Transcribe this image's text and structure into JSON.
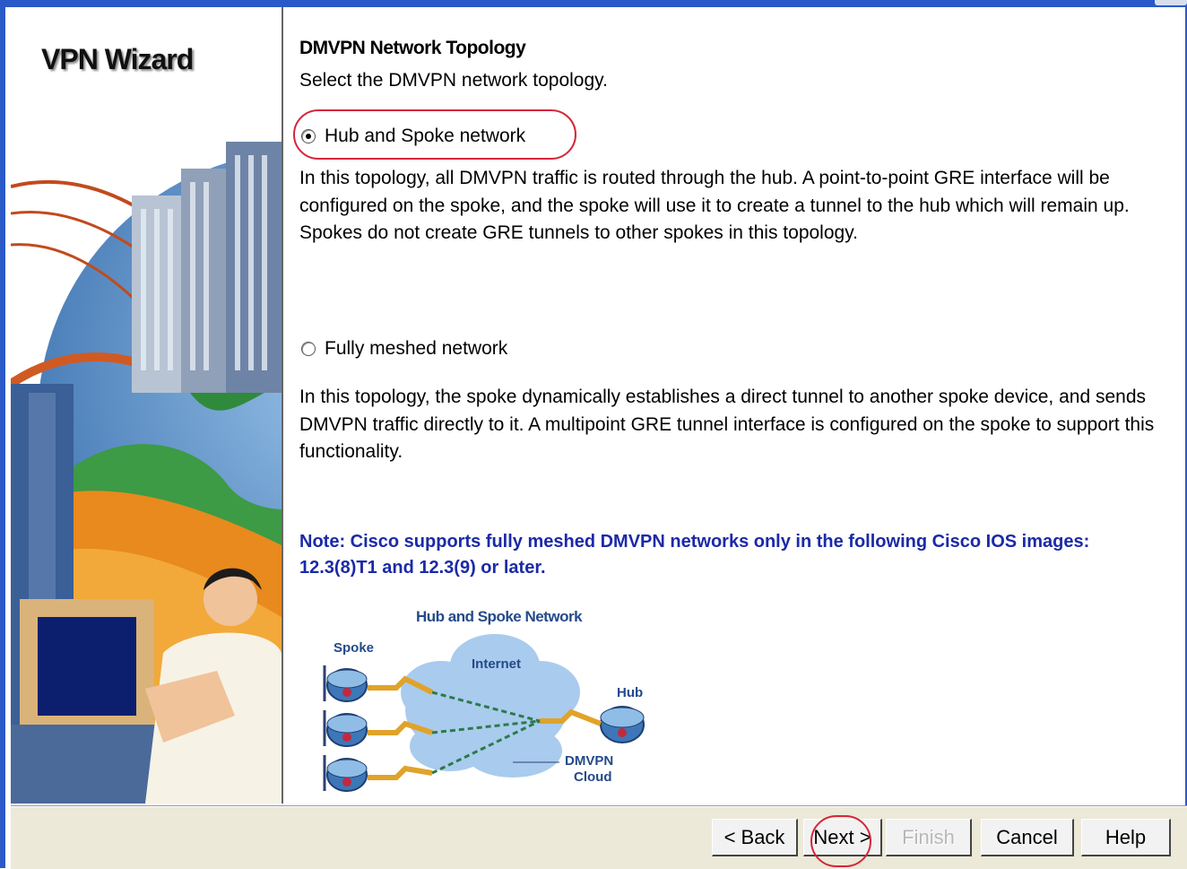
{
  "wizard": {
    "title": "VPN Wizard"
  },
  "page": {
    "heading": "DMVPN Network Topology",
    "subtitle": "Select the DMVPN network topology."
  },
  "options": [
    {
      "label": "Hub and Spoke network",
      "selected": true,
      "description": "In this topology, all DMVPN traffic is routed through the hub. A point-to-point GRE interface will be configured on the spoke, and the spoke will use it to create a tunnel to the hub which will remain up. Spokes do not create GRE tunnels to other spokes in this topology."
    },
    {
      "label": "Fully meshed network",
      "selected": false,
      "description": "In this topology, the spoke dynamically establishes a direct tunnel  to another spoke device, and sends DMVPN traffic directly to it. A multipoint GRE tunnel interface is configured on the spoke to support this functionality."
    }
  ],
  "note": "Note: Cisco supports fully meshed DMVPN networks only in the following Cisco IOS images: 12.3(8)T1 and 12.3(9) or later.",
  "diagram": {
    "title": "Hub and Spoke Network",
    "spoke_label": "Spoke",
    "internet_label": "Internet",
    "hub_label": "Hub",
    "cloud_label_1": "DMVPN",
    "cloud_label_2": "Cloud"
  },
  "buttons": {
    "back": "< Back",
    "next": "Next >",
    "finish": "Finish",
    "cancel": "Cancel",
    "help": "Help"
  },
  "colors": {
    "title_bar": "#2b59c7",
    "note_text": "#1b2aa7",
    "highlight": "#d4263a"
  }
}
